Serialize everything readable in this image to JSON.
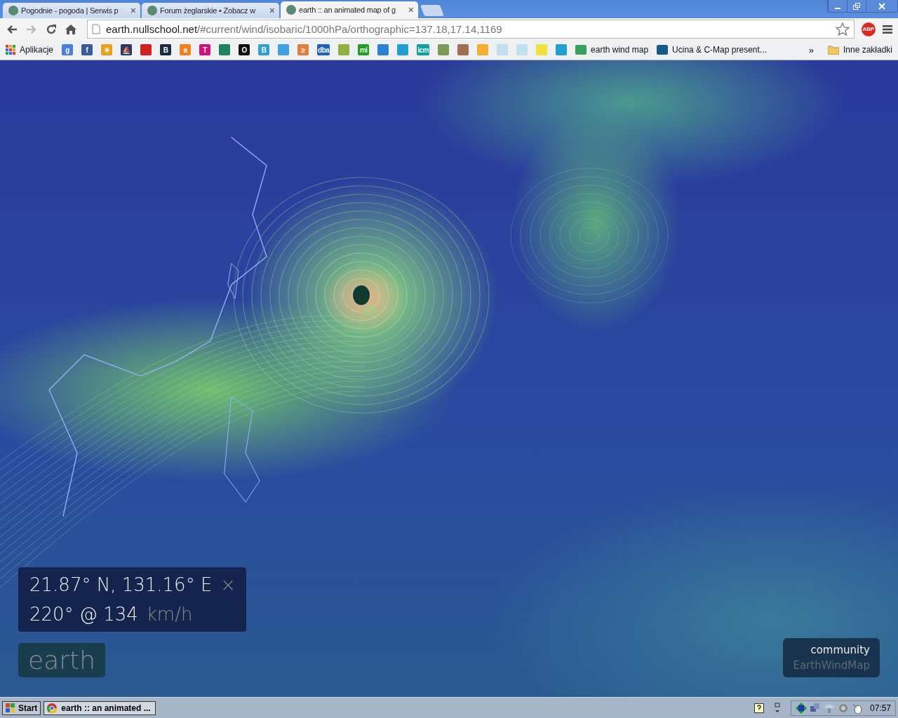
{
  "tabs": [
    {
      "title": "Pogodnie - pogoda | Serwis p",
      "close": "×",
      "selected": false
    },
    {
      "title": "Forum żeglarskie • Zobacz w",
      "close": "×",
      "selected": false
    },
    {
      "title": "earth :: an animated map of g",
      "close": "×",
      "selected": true
    }
  ],
  "toolbar": {
    "url_host": "earth.nullschool.net",
    "url_path": "/#current/wind/isobaric/1000hPa/orthographic=137.18,17.14,1169",
    "adblock": "ABP"
  },
  "bookmarks": [
    {
      "kind": "apps",
      "label": "Aplikacje"
    },
    {
      "kind": "icon",
      "glyph": "g",
      "color": "#4a7fe0"
    },
    {
      "kind": "icon",
      "glyph": "f",
      "color": "#3b5998"
    },
    {
      "kind": "icon",
      "glyph": "☀",
      "color": "#e8a020"
    },
    {
      "kind": "icon",
      "glyph": "⛵",
      "color": "#2a3a60"
    },
    {
      "kind": "icon",
      "color": "#d02020"
    },
    {
      "kind": "icon",
      "glyph": "B",
      "color": "#1a2a40"
    },
    {
      "kind": "icon",
      "glyph": "a",
      "color": "#f08020"
    },
    {
      "kind": "icon",
      "glyph": "T",
      "color": "#d0107a"
    },
    {
      "kind": "icon",
      "color": "#208060"
    },
    {
      "kind": "icon",
      "glyph": "O",
      "color": "#111111"
    },
    {
      "kind": "icon",
      "glyph": "B",
      "color": "#30a0d0"
    },
    {
      "kind": "icon",
      "color": "#40a0e0"
    },
    {
      "kind": "icon",
      "glyph": "≥",
      "color": "#e08040"
    },
    {
      "kind": "icon",
      "glyph": "dba",
      "color": "#2060c0"
    },
    {
      "kind": "icon",
      "color": "#90b040"
    },
    {
      "kind": "icon",
      "glyph": "mi",
      "color": "#20a020"
    },
    {
      "kind": "icon",
      "color": "#3080d0"
    },
    {
      "kind": "icon",
      "color": "#20a0d0"
    },
    {
      "kind": "icon",
      "glyph": "icm",
      "color": "#10a0a0"
    },
    {
      "kind": "icon",
      "color": "#7a9a5a"
    },
    {
      "kind": "icon",
      "color": "#a07050"
    },
    {
      "kind": "icon",
      "color": "#f0b030"
    },
    {
      "kind": "icon",
      "color": "#c0e0f0"
    },
    {
      "kind": "icon",
      "color": "#c0e0f0"
    },
    {
      "kind": "icon",
      "color": "#f0e040"
    },
    {
      "kind": "icon",
      "color": "#20a0d0"
    },
    {
      "kind": "link",
      "label": "earth wind map",
      "color": "#3aa060"
    },
    {
      "kind": "link",
      "label": "Ucina & C-Map present...",
      "color": "#1a5a8a"
    }
  ],
  "bookmarks_more": "»",
  "other_bookmarks": "Inne zakładki",
  "info": {
    "location": "21.87° N, 131.16° E",
    "close": "×",
    "wind": "220° @ 134",
    "unit": "km/h"
  },
  "logo": "earth",
  "community": {
    "title": "community",
    "link": "EarthWindMap"
  },
  "taskbar": {
    "start": "Start",
    "task": "earth :: an animated ...",
    "clock": "07:57"
  }
}
